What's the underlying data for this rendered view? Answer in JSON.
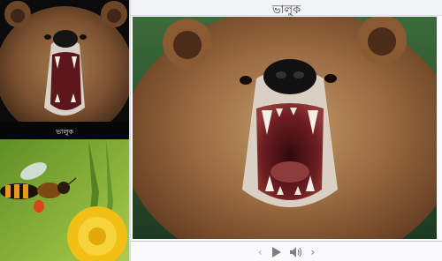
{
  "sidebar": {
    "items": [
      {
        "caption": "ভালুক",
        "icon": "bear-thumbnail"
      },
      {
        "caption": "",
        "icon": "bee-thumbnail"
      }
    ]
  },
  "viewer": {
    "title": "ভালুক",
    "image_icon": "bear-photo"
  },
  "controls": {
    "prev_label": "‹",
    "next_label": "›",
    "play_icon": "play-icon",
    "sound_icon": "speaker-icon"
  },
  "colors": {
    "bear_fur": "#8a5a33",
    "bear_mouth": "#6e1d21",
    "bee_stripes": "#e89a1c",
    "dandelion": "#f3c21a",
    "grass": "#7fae35"
  }
}
